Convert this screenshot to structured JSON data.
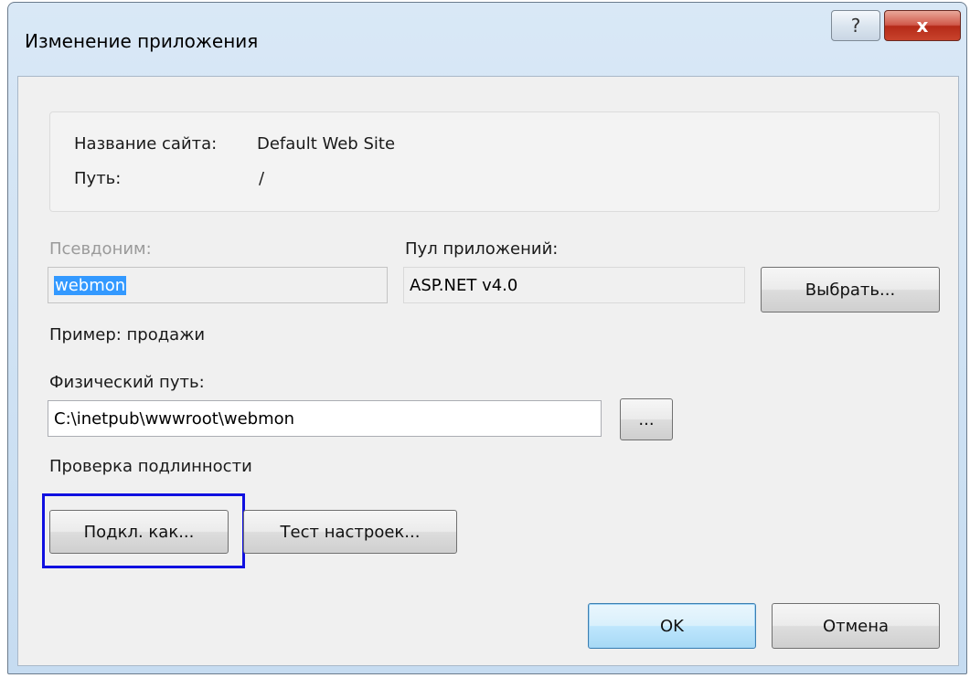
{
  "window": {
    "title": "Изменение приложения",
    "help_label": "?",
    "close_label": "x"
  },
  "info": {
    "site_name_label": "Название сайта:",
    "site_name_value": "Default Web Site",
    "path_label": "Путь:",
    "path_value": "/"
  },
  "alias": {
    "label": "Псевдоним:",
    "value": "webmon",
    "example": "Пример: продажи"
  },
  "app_pool": {
    "label": "Пул приложений:",
    "value": "ASP.NET v4.0",
    "select_button": "Выбрать..."
  },
  "physical_path": {
    "label": "Физический путь:",
    "value": "C:\\inetpub\\wwwroot\\webmon",
    "browse_button": "..."
  },
  "authentication": {
    "label": "Проверка подлинности",
    "connect_as_button": "Подкл. как...",
    "test_settings_button": "Тест настроек..."
  },
  "footer": {
    "ok_button": "OK",
    "cancel_button": "Отмена"
  },
  "colors": {
    "selection": "#3399ff",
    "highlight_border": "#1010e0",
    "close_button": "#c8432c"
  }
}
